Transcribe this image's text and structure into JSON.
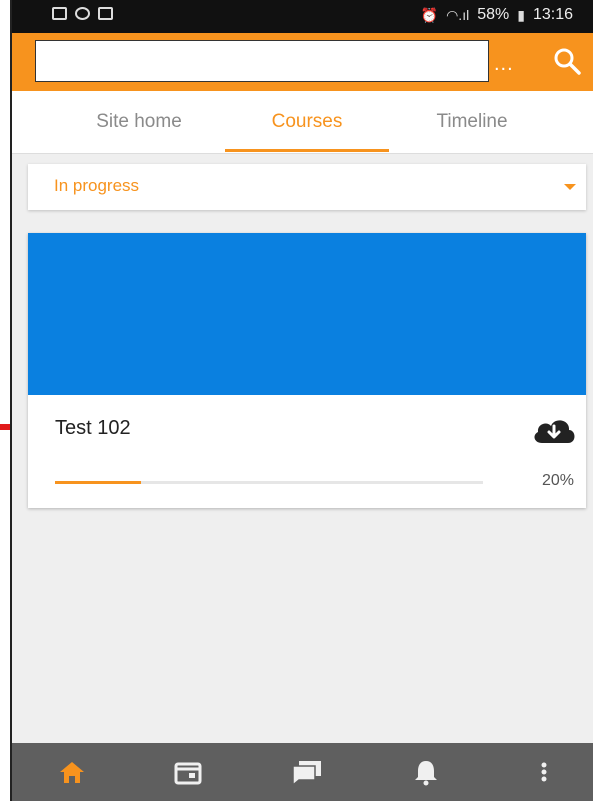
{
  "status_bar": {
    "battery": "58%",
    "time": "13:16"
  },
  "app_bar": {
    "title": "",
    "overflow_label": "..."
  },
  "tabs": [
    {
      "label": "Site home",
      "active": false
    },
    {
      "label": "Courses",
      "active": true
    },
    {
      "label": "Timeline",
      "active": false
    }
  ],
  "filter": {
    "selected": "In progress"
  },
  "course": {
    "name": "Test 102",
    "image_color": "#0a80e0",
    "progress_percent": 20,
    "progress_label": "20%"
  },
  "bottom_nav": [
    {
      "icon": "home-icon",
      "active": true
    },
    {
      "icon": "calendar-icon",
      "active": false
    },
    {
      "icon": "messages-icon",
      "active": false
    },
    {
      "icon": "bell-icon",
      "active": false
    },
    {
      "icon": "more-vertical-icon",
      "active": false
    }
  ],
  "colors": {
    "accent": "#f7931e",
    "status_bar": "#111111",
    "bottom_nav": "#5f5f5f",
    "annotation_arrow": "#e11a1a"
  }
}
